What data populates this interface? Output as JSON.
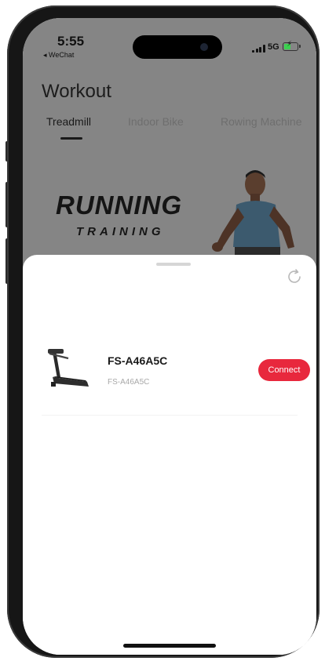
{
  "status_bar": {
    "time": "5:55",
    "back_app": "◂ WeChat",
    "network": "5G",
    "battery_level": 0.55,
    "charging": true
  },
  "page": {
    "title": "Workout"
  },
  "tabs": [
    {
      "label": "Treadmill",
      "active": true
    },
    {
      "label": "Indoor Bike",
      "active": false
    },
    {
      "label": "Rowing Machine",
      "active": false
    }
  ],
  "banner": {
    "title": "RUNNING",
    "subtitle": "TRAINING"
  },
  "device_sheet": {
    "devices": [
      {
        "name": "FS-A46A5C",
        "id": "FS-A46A5C",
        "action_label": "Connect",
        "icon": "treadmill-icon"
      }
    ]
  },
  "colors": {
    "accent": "#e8283d",
    "overlay_dim": "#858585",
    "battery_green": "#3bd14f"
  }
}
